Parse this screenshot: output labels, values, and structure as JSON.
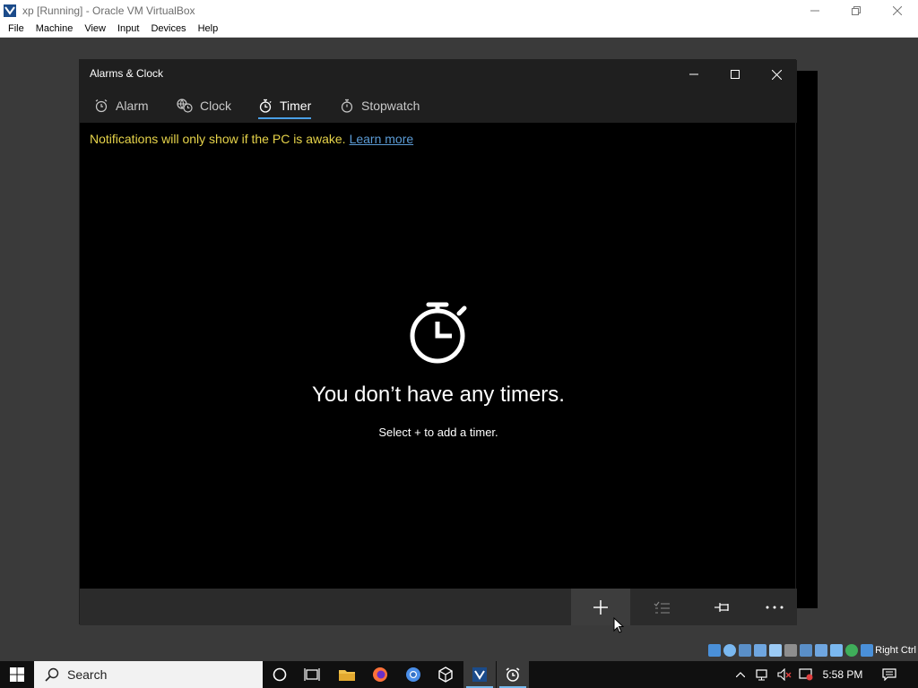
{
  "host": {
    "title": "xp [Running] - Oracle VM VirtualBox",
    "menu": [
      "File",
      "Machine",
      "View",
      "Input",
      "Devices",
      "Help"
    ],
    "host_key": "Right Ctrl"
  },
  "app": {
    "title": "Alarms & Clock",
    "tabs": [
      {
        "label": "Alarm",
        "icon": "alarm-icon"
      },
      {
        "label": "Clock",
        "icon": "globe-clock-icon"
      },
      {
        "label": "Timer",
        "icon": "timer-icon",
        "active": true
      },
      {
        "label": "Stopwatch",
        "icon": "stopwatch-icon"
      }
    ],
    "notice": "Notifications will only show if the PC is awake.",
    "notice_link": "Learn more",
    "empty_title": "You don’t have any timers.",
    "empty_subtitle": "Select + to add a timer.",
    "commands": [
      "add-icon",
      "select-list-icon",
      "pin-icon",
      "more-icon"
    ],
    "accent_color": "#4a9fe6",
    "notice_color": "#e6d34a"
  },
  "taskbar": {
    "search_label": "Search",
    "time": "5:58 PM",
    "pinned_icons": [
      "cortana-icon",
      "task-view-icon",
      "file-explorer-icon",
      "firefox-icon",
      "chrome-icon",
      "virtualbox-icon",
      "vbox-manager-icon",
      "alarms-clock-icon"
    ]
  }
}
